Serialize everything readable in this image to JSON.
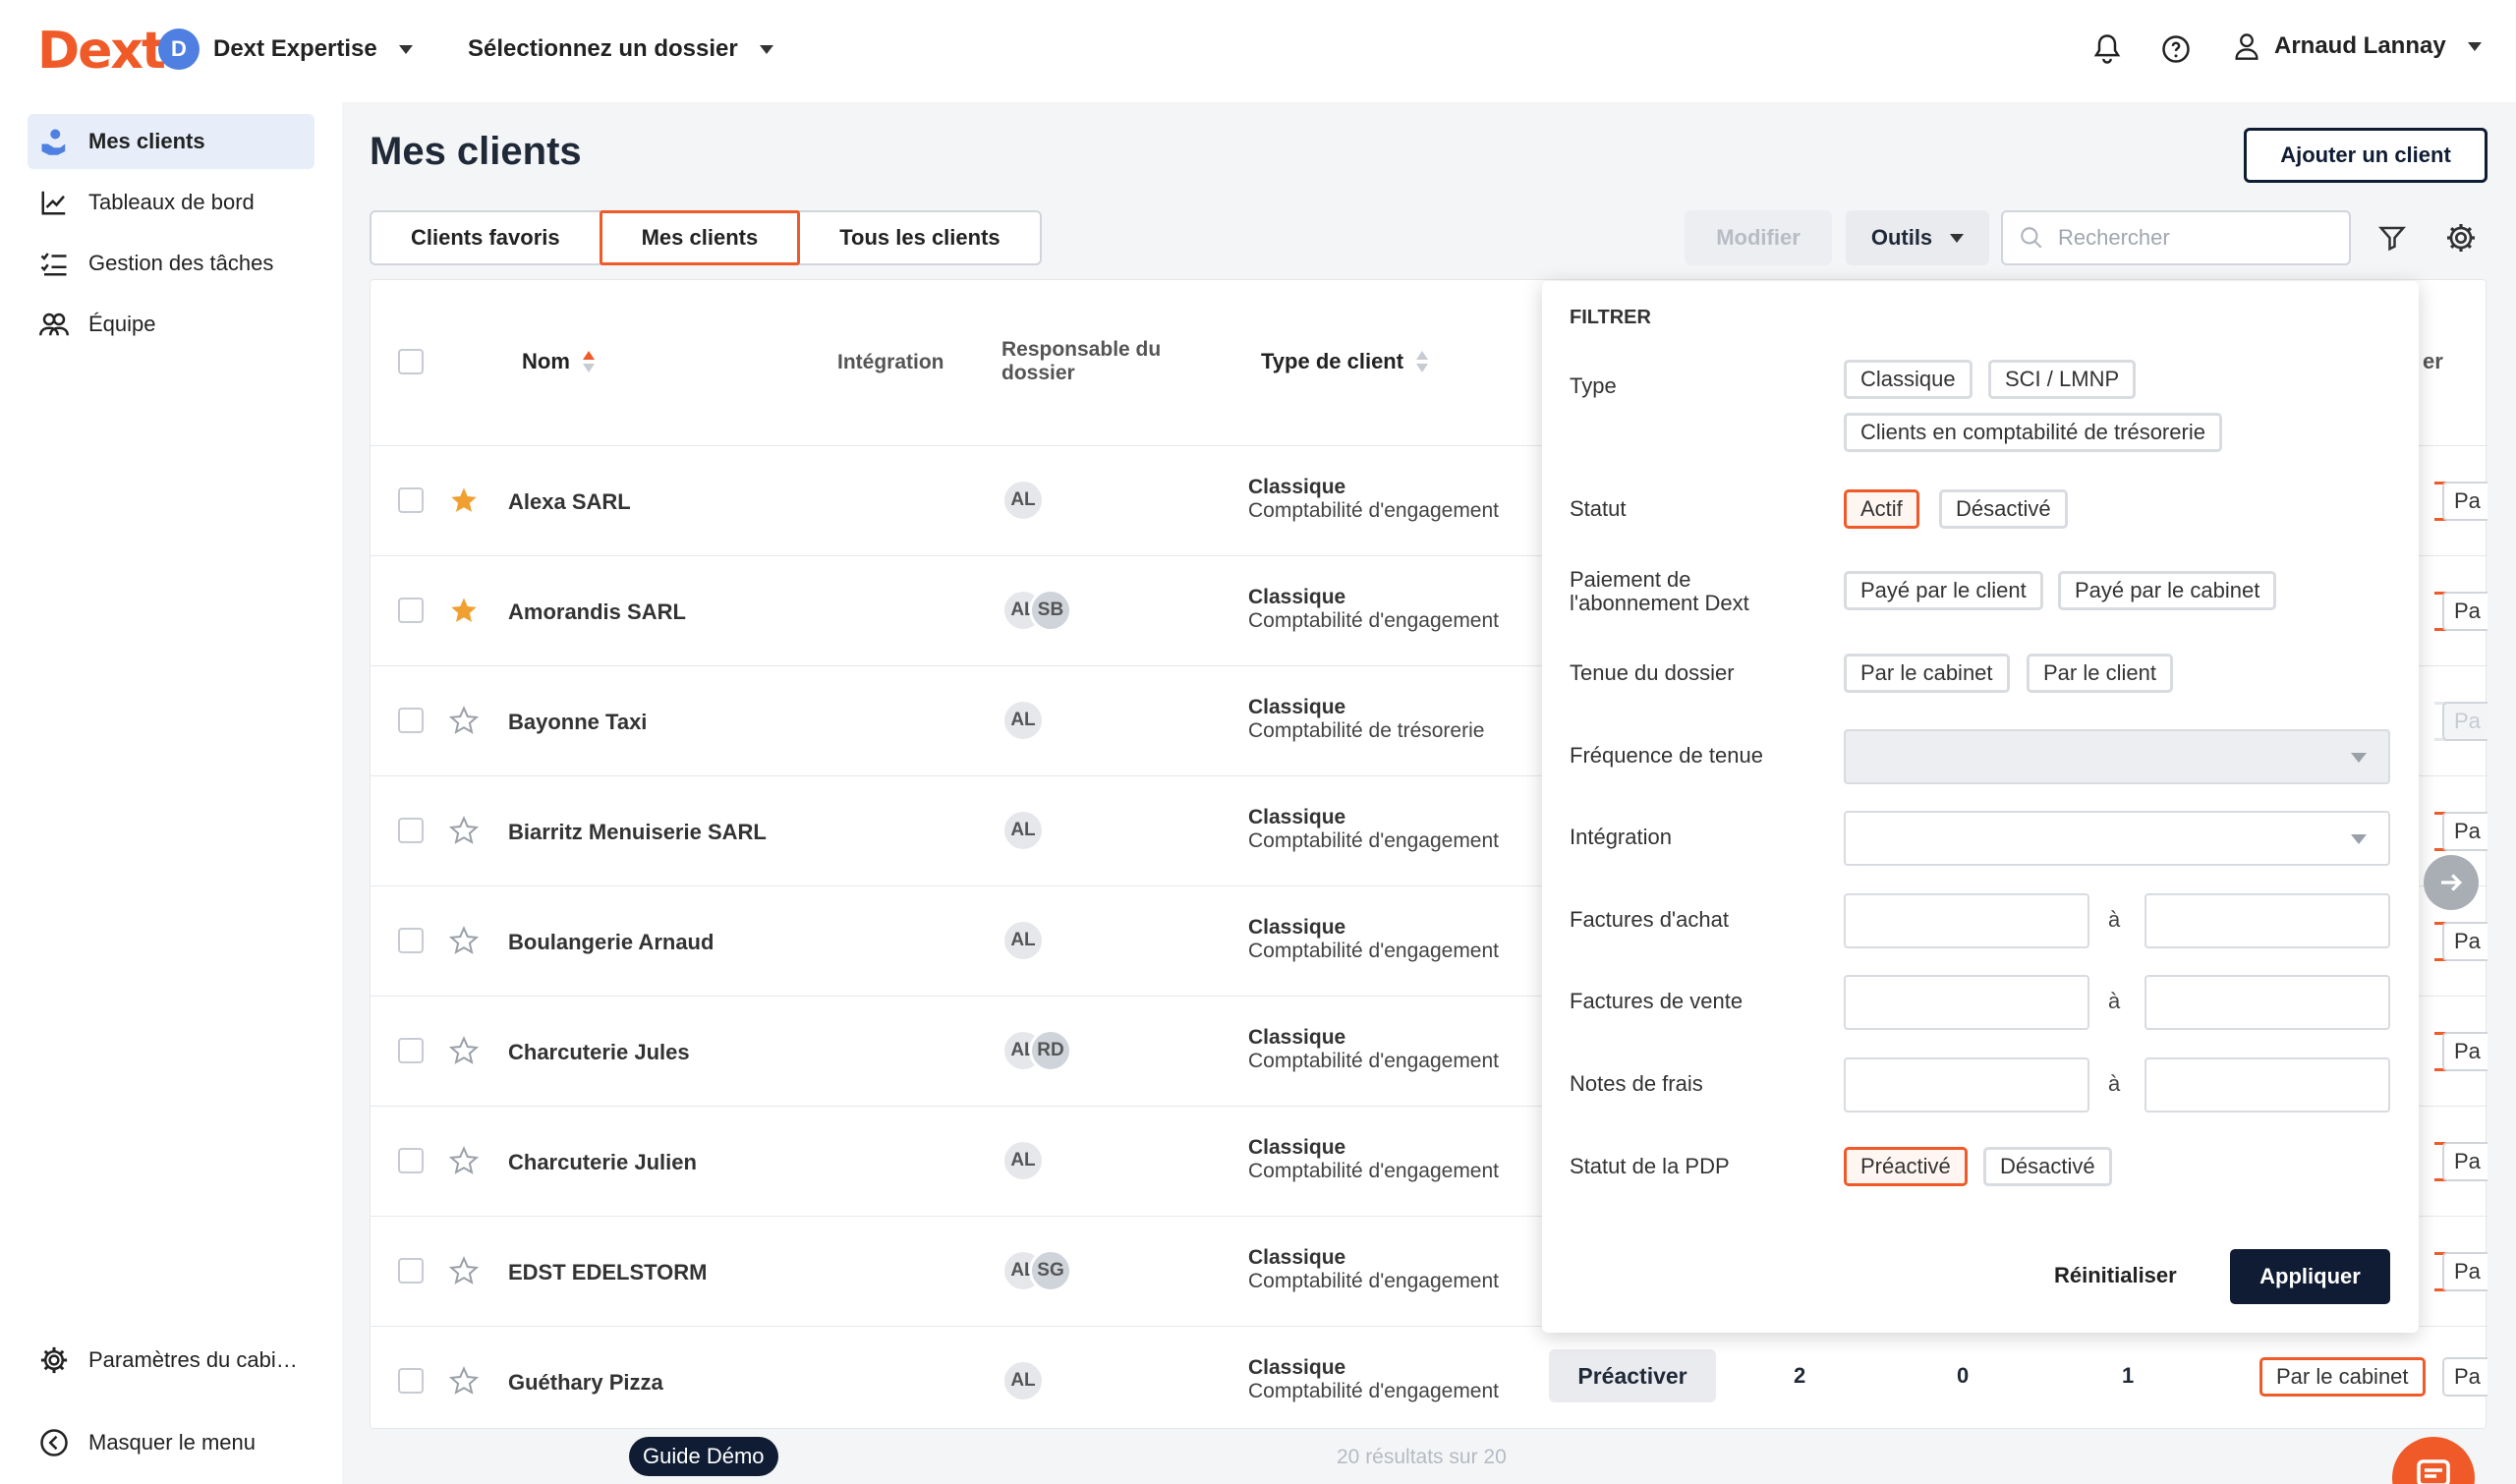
{
  "header": {
    "logo": "Dext",
    "workspace_initial": "D",
    "workspace_name": "Dext Expertise",
    "folder_select": "Sélectionnez un dossier",
    "user_name": "Arnaud Lannay"
  },
  "sidebar": {
    "items": [
      {
        "label": "Mes clients",
        "icon": "clients-icon"
      },
      {
        "label": "Tableaux de bord",
        "icon": "chart-line-icon"
      },
      {
        "label": "Gestion des tâches",
        "icon": "task-list-icon"
      },
      {
        "label": "Équipe",
        "icon": "team-icon"
      }
    ],
    "settings_label": "Paramètres du cabi…",
    "hide_menu_label": "Masquer le menu"
  },
  "main": {
    "title": "Mes clients",
    "add_client_label": "Ajouter un client",
    "tabs": [
      "Clients favoris",
      "Mes clients",
      "Tous les clients"
    ],
    "active_tab": "Mes clients",
    "modify_label": "Modifier",
    "tools_label": "Outils",
    "search_placeholder": "Rechercher"
  },
  "table": {
    "headers": {
      "name": "Nom",
      "integration": "Intégration",
      "responsible": "Responsable du dossier",
      "client_type": "Type de client",
      "partial": "er"
    },
    "rows": [
      {
        "name": "Alexa SARL",
        "favorite": true,
        "avatars": [
          "AL"
        ],
        "type": "Classique",
        "accounting": "Comptabilité d'engagement"
      },
      {
        "name": "Amorandis SARL",
        "favorite": true,
        "avatars": [
          "AL",
          "SB"
        ],
        "type": "Classique",
        "accounting": "Comptabilité d'engagement"
      },
      {
        "name": "Bayonne Taxi",
        "favorite": false,
        "avatars": [
          "AL"
        ],
        "type": "Classique",
        "accounting": "Comptabilité de trésorerie"
      },
      {
        "name": "Biarritz Menuiserie SARL",
        "favorite": false,
        "avatars": [
          "AL"
        ],
        "type": "Classique",
        "accounting": "Comptabilité d'engagement"
      },
      {
        "name": "Boulangerie Arnaud",
        "favorite": false,
        "avatars": [
          "AL"
        ],
        "type": "Classique",
        "accounting": "Comptabilité d'engagement"
      },
      {
        "name": "Charcuterie Jules",
        "favorite": false,
        "avatars": [
          "AL",
          "RD"
        ],
        "type": "Classique",
        "accounting": "Comptabilité d'engagement"
      },
      {
        "name": "Charcuterie Julien",
        "favorite": false,
        "avatars": [
          "AL"
        ],
        "type": "Classique",
        "accounting": "Comptabilité d'engagement"
      },
      {
        "name": "EDST EDELSTORM",
        "favorite": false,
        "avatars": [
          "AL",
          "SG"
        ],
        "type": "Classique",
        "accounting": "Comptabilité d'engagement"
      },
      {
        "name": "Guéthary Pizza",
        "favorite": false,
        "avatars": [
          "AL"
        ],
        "type": "Classique",
        "accounting": "Comptabilité d'engagement"
      }
    ],
    "last_row_extra": {
      "pdp_button": "Préactiver",
      "purchase": "2",
      "sales": "0",
      "expenses": "1",
      "holder": "Par le cabinet",
      "partial": "Pa"
    },
    "partial_cell": "Pa",
    "results": "20 résultats sur 20"
  },
  "filter": {
    "title": "FILTRER",
    "type_label": "Type",
    "type_options": [
      "Classique",
      "SCI / LMNP",
      "Clients en comptabilité de trésorerie"
    ],
    "status_label": "Statut",
    "status_options": [
      "Actif",
      "Désactivé"
    ],
    "payment_label": "Paiement de l'abonnement Dext",
    "payment_options": [
      "Payé par le client",
      "Payé par le cabinet"
    ],
    "holding_label": "Tenue du dossier",
    "holding_options": [
      "Par le cabinet",
      "Par le client"
    ],
    "frequency_label": "Fréquence de tenue",
    "integration_label": "Intégration",
    "purchase_label": "Factures d'achat",
    "sales_label": "Factures de vente",
    "expenses_label": "Notes de frais",
    "to_label": "à",
    "pdp_label": "Statut de la PDP",
    "pdp_options": [
      "Préactivé",
      "Désactivé"
    ],
    "reset_label": "Réinitialiser",
    "apply_label": "Appliquer"
  },
  "guide_label": "Guide Démo",
  "colors": {
    "brand": "#f05a28",
    "dark": "#0f1c33",
    "star": "#f0a030"
  }
}
